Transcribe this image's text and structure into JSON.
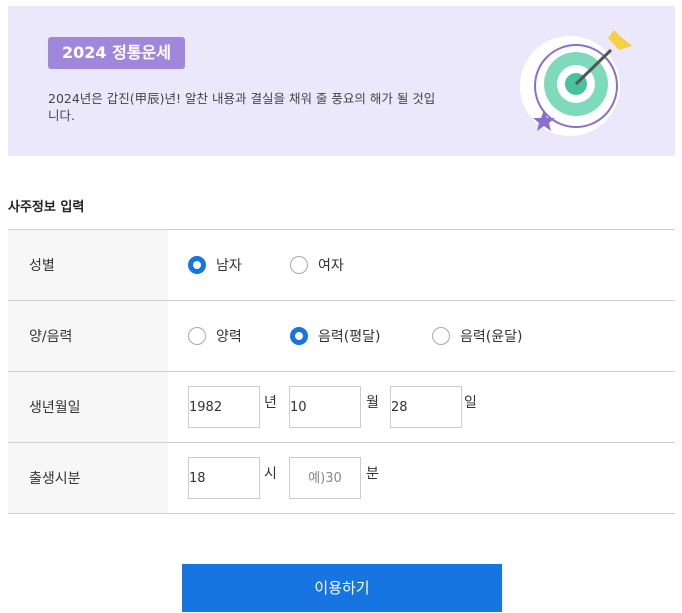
{
  "banner": {
    "badge": "2024 정통운세",
    "description": "2024년은 갑진(甲辰)년! 알찬 내용과 결실을 채워 줄 풍요의 해가 될 것입니다."
  },
  "section_title": "사주정보 입력",
  "gender": {
    "label": "성별",
    "options": [
      "남자",
      "여자"
    ],
    "selected": "남자"
  },
  "calendar": {
    "label": "양/음력",
    "options": [
      "양력",
      "음력(평달)",
      "음력(윤달)"
    ],
    "selected": "음력(평달)"
  },
  "birthdate": {
    "label": "생년월일",
    "year": "1982",
    "year_unit": "년",
    "month": "10",
    "month_unit": "월",
    "day": "28",
    "day_unit": "일"
  },
  "birthtime": {
    "label": "출생시분",
    "hour": "18",
    "hour_unit": "시",
    "minute_placeholder": "예)30",
    "minute_unit": "분"
  },
  "submit_label": "이용하기",
  "colors": {
    "accent": "#1675e0",
    "banner_bg": "#ece8fb",
    "badge_bg": "#a187dc"
  }
}
